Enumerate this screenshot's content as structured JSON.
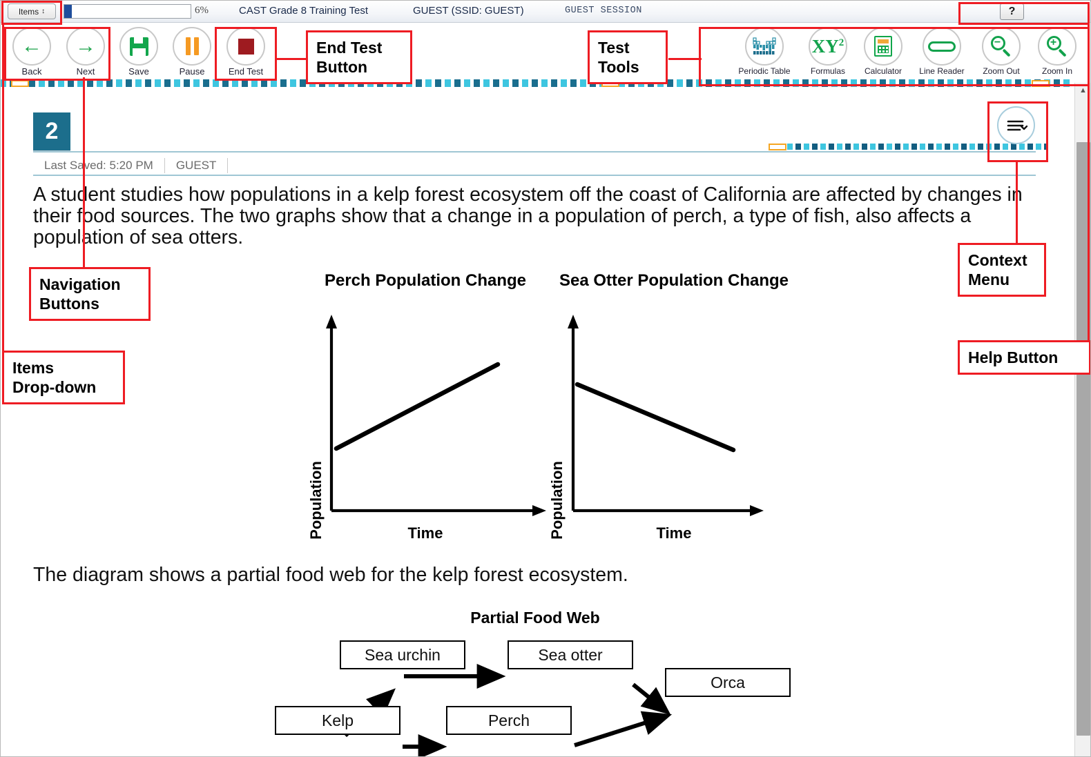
{
  "topbar": {
    "items_dropdown_label": "Items",
    "items_dropdown_icon": "updown-chevron-icon",
    "progress_percent_label": "6%",
    "progress_percent_value": 6,
    "test_name": "CAST Grade 8 Training Test",
    "student_label": "GUEST (SSID: GUEST)",
    "session_label": "GUEST SESSION",
    "help_button_label": "?"
  },
  "toolbar": {
    "buttons": [
      {
        "label": "Back",
        "icon": "arrow-left-icon",
        "glyph": "←"
      },
      {
        "label": "Next",
        "icon": "arrow-right-icon",
        "glyph": "→"
      },
      {
        "label": "Save",
        "icon": "floppy-disk-icon"
      },
      {
        "label": "Pause",
        "icon": "pause-icon"
      },
      {
        "label": "End Test",
        "icon": "stop-square-icon"
      }
    ],
    "tools": [
      {
        "label": "Periodic Table",
        "icon": "periodic-table-icon"
      },
      {
        "label": "Formulas",
        "icon": "xy-squared-icon",
        "glyph": "XY",
        "sup": "2"
      },
      {
        "label": "Calculator",
        "icon": "calculator-icon"
      },
      {
        "label": "Line Reader",
        "icon": "line-reader-icon"
      },
      {
        "label": "Zoom Out",
        "icon": "zoom-out-icon",
        "sign": "−"
      },
      {
        "label": "Zoom In",
        "icon": "zoom-in-icon",
        "sign": "+"
      }
    ]
  },
  "item": {
    "number": "2",
    "last_saved_label": "Last Saved: 5:20 PM",
    "user_label": "GUEST",
    "context_menu_icon": "hamburger-chevron-icon",
    "stem_paragraph_1": "A student studies how populations in a kelp forest ecosystem off the coast of California are affected by changes in their food sources. The two graphs show that a change in a population of perch, a type of fish, also affects a population of sea otters.",
    "stem_paragraph_2": "The diagram shows a partial food web for the kelp forest ecosystem."
  },
  "chart_data": [
    {
      "type": "line",
      "title": "Perch Population Change",
      "xlabel": "Time",
      "ylabel": "Population",
      "trend": "increasing",
      "x": [
        0,
        1
      ],
      "y": [
        0.3,
        0.78
      ],
      "grid": false,
      "axis_arrows": true,
      "tick_labels": []
    },
    {
      "type": "line",
      "title": "Sea Otter Population Change",
      "xlabel": "Time",
      "ylabel": "Population",
      "trend": "decreasing",
      "x": [
        0,
        1
      ],
      "y": [
        0.72,
        0.32
      ],
      "grid": false,
      "axis_arrows": true,
      "tick_labels": []
    }
  ],
  "food_web": {
    "title": "Partial Food Web",
    "nodes": [
      {
        "id": "sea-urchin",
        "label": "Sea urchin"
      },
      {
        "id": "sea-otter",
        "label": "Sea otter"
      },
      {
        "id": "orca",
        "label": "Orca"
      },
      {
        "id": "kelp",
        "label": "Kelp"
      },
      {
        "id": "perch",
        "label": "Perch"
      }
    ],
    "edges": [
      {
        "from": "kelp",
        "to": "sea-urchin"
      },
      {
        "from": "sea-urchin",
        "to": "sea-otter"
      },
      {
        "from": "sea-otter",
        "to": "orca"
      },
      {
        "from": "kelp",
        "to": "perch"
      },
      {
        "from": "perch",
        "to": "orca"
      }
    ]
  },
  "annotations": [
    {
      "id": "end-test-button",
      "text": "End Test\nButton",
      "line1": "End Test",
      "line2": "Button"
    },
    {
      "id": "test-tools",
      "text": "Test\nTools",
      "line1": "Test",
      "line2": "Tools"
    },
    {
      "id": "navigation-buttons",
      "line1": "Navigation",
      "line2": "Buttons"
    },
    {
      "id": "items-dropdown",
      "line1": "Items",
      "line2": "Drop-down"
    },
    {
      "id": "context-menu",
      "line1": "Context",
      "line2": "Menu"
    },
    {
      "id": "help-button",
      "line1": "Help Button",
      "line2": ""
    }
  ],
  "colors": {
    "accent_teal": "#1c6e8c",
    "annotation_red": "#ee1c23",
    "green_icon": "#12a24c",
    "orange_icon": "#f59a23",
    "stop_red": "#9e1b20",
    "progress_blue": "#1f4e9c",
    "dash_cyan": "#3ec6e0",
    "dash_navy": "#135d80"
  }
}
